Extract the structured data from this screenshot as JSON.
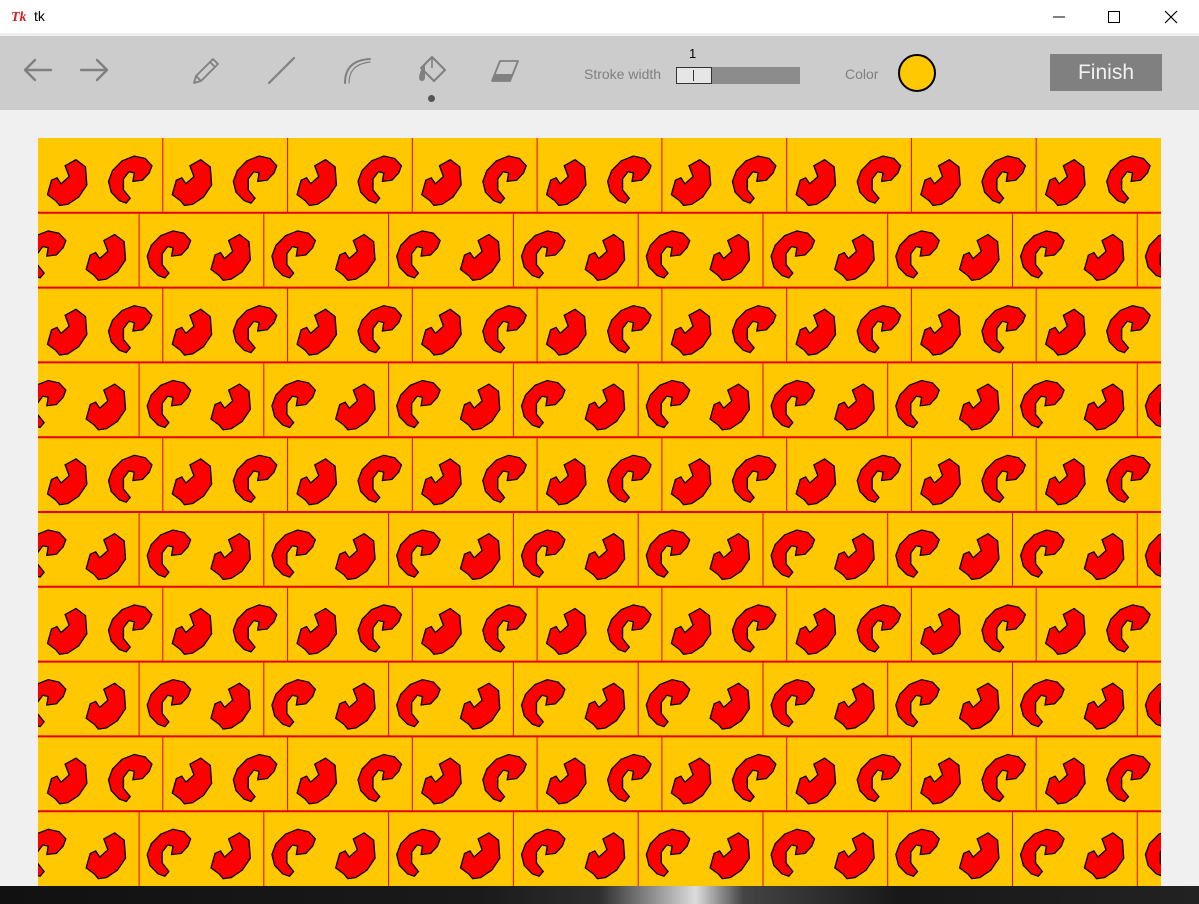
{
  "window": {
    "title": "tk",
    "icon": "tk-feather-icon",
    "controls": [
      "minimize-icon",
      "maximize-icon",
      "close-icon"
    ]
  },
  "toolbar": {
    "tools": [
      {
        "name": "undo",
        "icon": "arrow-left-icon"
      },
      {
        "name": "redo",
        "icon": "arrow-right-icon"
      },
      {
        "name": "pencil",
        "icon": "pencil-icon"
      },
      {
        "name": "line",
        "icon": "line-icon"
      },
      {
        "name": "curve",
        "icon": "curve-icon"
      },
      {
        "name": "fill",
        "icon": "paint-bucket-icon",
        "selected": true
      },
      {
        "name": "eraser",
        "icon": "eraser-icon"
      }
    ],
    "stroke_width_label": "Stroke width",
    "stroke_width_value": "1",
    "color_label": "Color",
    "color_value": "#ffc800",
    "finish_label": "Finish"
  },
  "canvas": {
    "background_color": "#ffc800",
    "shape_color": "#ff0000",
    "outline_color": "#000000",
    "grid_line_color": "#e60000",
    "rows": 10,
    "tiles_per_row": 18,
    "pattern": "alternating tessellated curled-arrow tiles"
  }
}
